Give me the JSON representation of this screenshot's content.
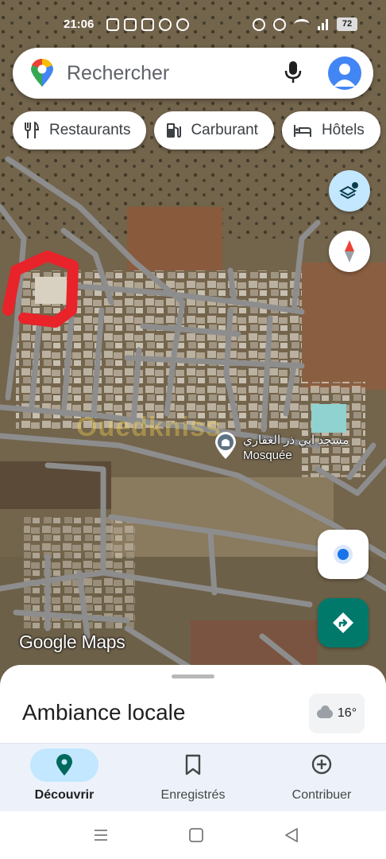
{
  "status_bar": {
    "time": "21:06",
    "battery": "72"
  },
  "search": {
    "placeholder": "Rechercher"
  },
  "chips": [
    {
      "label": "Restaurants",
      "icon": "restaurant-icon"
    },
    {
      "label": "Carburant",
      "icon": "fuel-icon"
    },
    {
      "label": "Hôtels",
      "icon": "hotel-icon"
    }
  ],
  "map": {
    "poi_name": "مسجد ابي ذر الغفاري",
    "poi_type": "Mosquée",
    "watermark": "Ouedkniss",
    "logo": "Google Maps"
  },
  "sheet": {
    "title": "Ambiance locale",
    "temperature": "16°"
  },
  "bottom_nav": [
    {
      "label": "Découvrir",
      "icon": "explore-pin-icon",
      "active": true
    },
    {
      "label": "Enregistrés",
      "icon": "bookmark-icon",
      "active": false
    },
    {
      "label": "Contribuer",
      "icon": "add-circle-icon",
      "active": false
    }
  ],
  "colors": {
    "accent": "#00796b",
    "chip_active_bg": "#c2e7ff",
    "annotation_red": "#e8232a"
  }
}
